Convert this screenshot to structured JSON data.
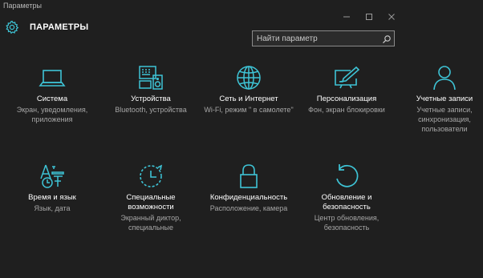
{
  "window": {
    "app_title": "Параметры"
  },
  "header": {
    "title": "ПАРАМЕТРЫ"
  },
  "search": {
    "placeholder": "Найти параметр"
  },
  "colors": {
    "accent": "#3ec4d6",
    "background": "#1f1f1f",
    "secondary_text": "#a6a6a6"
  },
  "tiles": [
    {
      "icon": "laptop-icon",
      "title": "Система",
      "desc": "Экран, уведомления, приложения"
    },
    {
      "icon": "devices-icon",
      "title": "Устройства",
      "desc": "Bluetooth, устройства"
    },
    {
      "icon": "globe-icon",
      "title": "Сеть и Интернет",
      "desc": "Wi-Fi, режим \" в самолете\""
    },
    {
      "icon": "personalization-icon",
      "title": "Персонализация",
      "desc": "Фон, экран блокировки"
    },
    {
      "icon": "person-icon",
      "title": "Учетные записи",
      "desc": "Учетные записи, синхронизация, пользователи"
    },
    {
      "icon": "time-language-icon",
      "title": "Время и язык",
      "desc": "Язык, дата"
    },
    {
      "icon": "ease-of-access-icon",
      "title": "Специальные возможности",
      "desc": "Экранный диктор, специальные"
    },
    {
      "icon": "lock-icon",
      "title": "Конфиденциальность",
      "desc": "Расположение, камера"
    },
    {
      "icon": "update-icon",
      "title": "Обновление и безопасность",
      "desc": "Центр обновления, безопасность"
    }
  ]
}
